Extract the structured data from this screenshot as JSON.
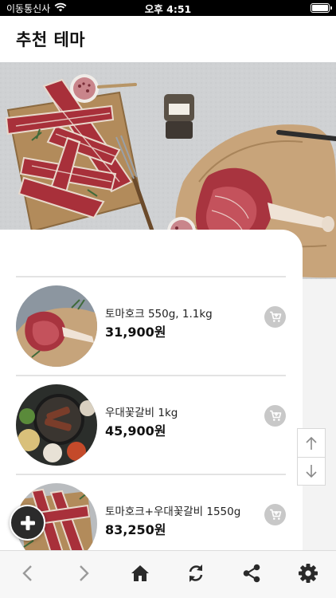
{
  "status_bar": {
    "carrier": "이동통신사",
    "time": "오후 4:51",
    "icons": [
      "wifi-icon",
      "battery-icon"
    ]
  },
  "header": {
    "title": "추천 테마"
  },
  "banner": {
    "image": "meat-banner"
  },
  "products": [
    {
      "name": "토마호크 550g, 1.1kg",
      "price": "31,900원",
      "icon": "cart-icon"
    },
    {
      "name": "우대꽃갈비 1kg",
      "price": "45,900원",
      "icon": "cart-icon"
    },
    {
      "name": "토마호크+우대꽃갈비 1550g",
      "price": "83,250원",
      "icon": "cart-icon"
    }
  ],
  "scroll": {
    "up_icon": "arrow-up-icon",
    "down_icon": "arrow-down-icon"
  },
  "fab": {
    "icon": "plus-icon"
  },
  "bottom_nav": {
    "items": [
      "back-icon",
      "forward-icon",
      "home-icon",
      "refresh-icon",
      "share-icon",
      "settings-icon"
    ]
  },
  "colors": {
    "status_bar": "#000000",
    "banner_background": "#cfd1d3",
    "cart_button": "#c8c8c8",
    "fab": "#2b2b2b",
    "nav_icon": "#2a2a2a",
    "nav_icon_inactive": "#9a9a9a"
  }
}
